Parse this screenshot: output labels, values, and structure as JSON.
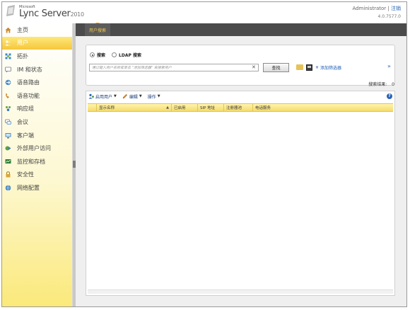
{
  "header": {
    "brand_small": "Microsoft",
    "brand_name": "Lync Server",
    "brand_year": "2010",
    "user": "Administrator",
    "separator": "|",
    "logout": "注销",
    "version": "4.0.7577.0"
  },
  "sidebar": {
    "items": [
      {
        "label": "主页",
        "icon": "home-icon",
        "active": false
      },
      {
        "label": "用户",
        "icon": "users-icon",
        "active": true
      },
      {
        "label": "拓扑",
        "icon": "topology-icon",
        "active": false
      },
      {
        "label": "IM 和状态",
        "icon": "im-presence-icon",
        "active": false
      },
      {
        "label": "语音路由",
        "icon": "voice-routing-icon",
        "active": false
      },
      {
        "label": "语音功能",
        "icon": "phone-icon",
        "active": false
      },
      {
        "label": "响应组",
        "icon": "response-group-icon",
        "active": false
      },
      {
        "label": "会议",
        "icon": "conferencing-icon",
        "active": false
      },
      {
        "label": "客户端",
        "icon": "clients-icon",
        "active": false
      },
      {
        "label": "外部用户访问",
        "icon": "external-access-icon",
        "active": false
      },
      {
        "label": "监控和存档",
        "icon": "monitoring-icon",
        "active": false
      },
      {
        "label": "安全性",
        "icon": "lock-icon",
        "active": false
      },
      {
        "label": "网络配置",
        "icon": "network-icon",
        "active": false
      }
    ]
  },
  "tabs": {
    "active": "用户搜索"
  },
  "search": {
    "option_search": "搜索",
    "option_ldap": "LDAP 搜索",
    "placeholder": "通过键入用户名称或单击 \"添加筛选器\" 来搜索用户",
    "find_button": "查找",
    "add_filter": "添加筛选器"
  },
  "results": {
    "label": "搜索结果:",
    "count": "0"
  },
  "toolbar": {
    "enable_users": "启用用户",
    "edit": "编辑",
    "action": "操作"
  },
  "table": {
    "columns": [
      "显示名称",
      "已启用",
      "SIP 地址",
      "注册器池",
      "电话服务"
    ],
    "rows": []
  },
  "colors": {
    "accent": "#f6c63b",
    "tab_text": "#f2c94c",
    "link": "#1f5fb6"
  }
}
